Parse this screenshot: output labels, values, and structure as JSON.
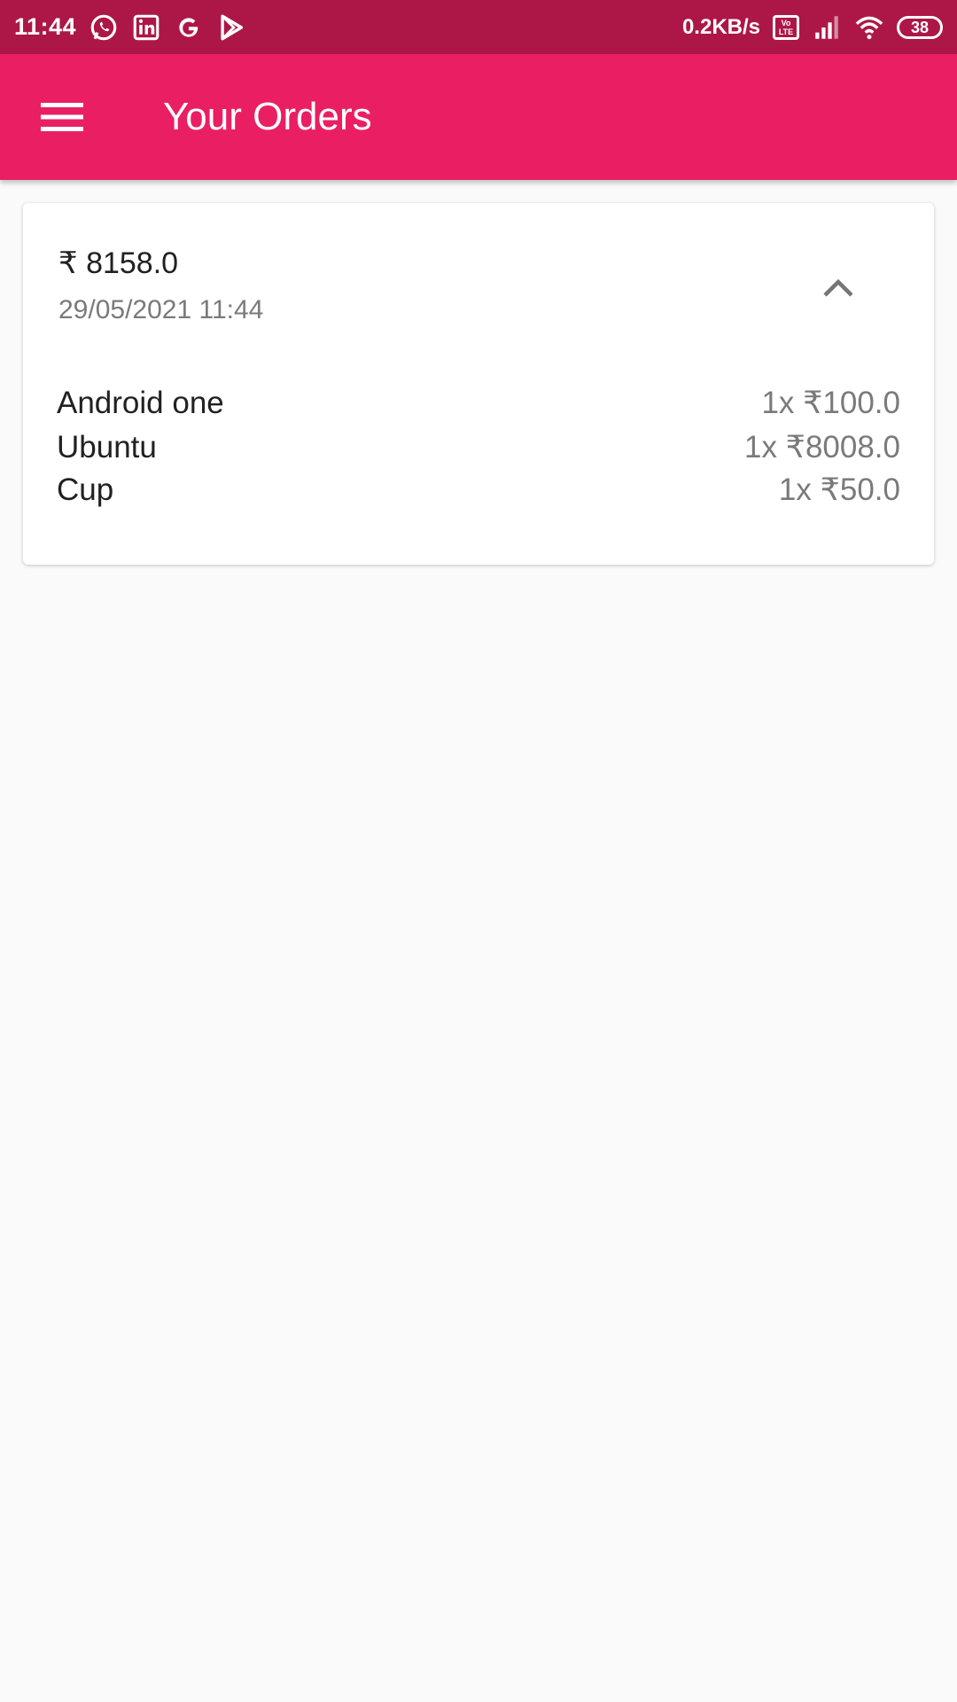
{
  "status_bar": {
    "time": "11:44",
    "app_icons": [
      "whatsapp-icon",
      "linkedin-icon",
      "google-icon",
      "play-store-icon"
    ],
    "network_speed": "0.2KB/s",
    "volte_label": "Vo LTE",
    "battery_level": "38"
  },
  "app_bar": {
    "title": "Your Orders",
    "menu_icon": "hamburger-menu-icon",
    "color": "#ea1f63"
  },
  "order": {
    "total": "₹ 8158.0",
    "date": "29/05/2021  11:44",
    "expanded": true,
    "items": [
      {
        "name": "Android one",
        "price": "1x ₹100.0"
      },
      {
        "name": "Ubuntu",
        "price": "1x ₹8008.0"
      },
      {
        "name": "Cup",
        "price": "1x ₹50.0"
      }
    ]
  },
  "colors": {
    "status_bar": "#ad1748",
    "app_bar": "#ea1f63",
    "background": "#fafafa"
  }
}
